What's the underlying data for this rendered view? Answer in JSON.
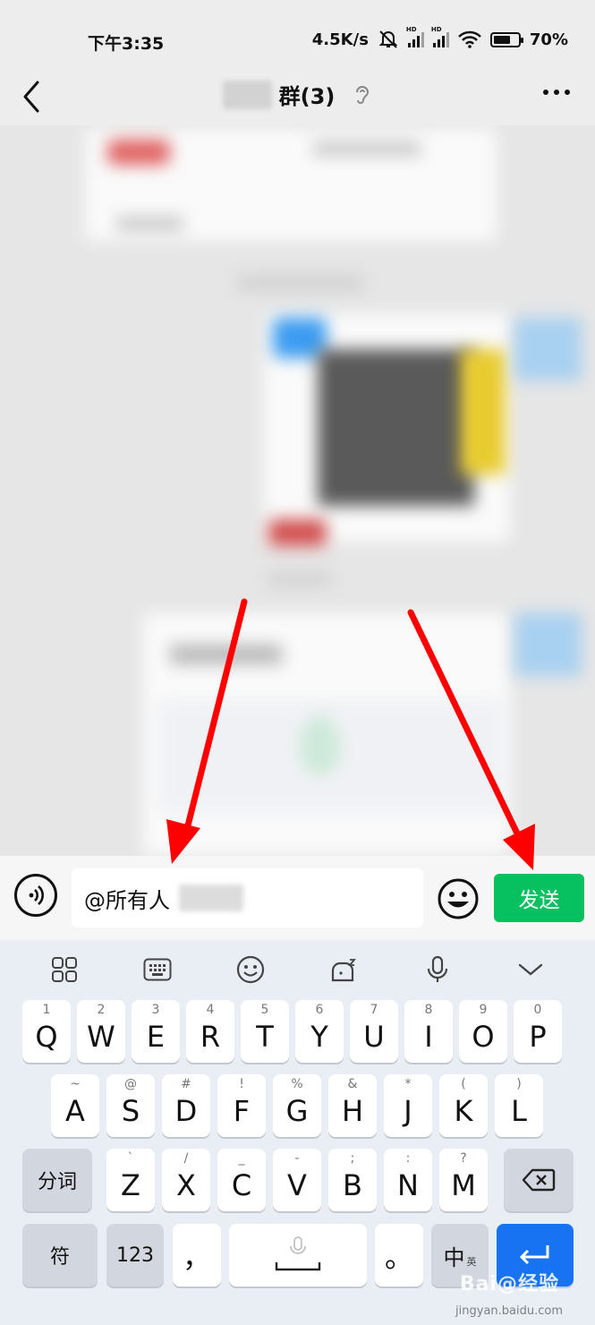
{
  "status_bar": {
    "time": "下午3:35",
    "net_speed": "4.5K/s",
    "signal_tag_1": "HD",
    "signal_tag_2": "HD",
    "battery": "70%"
  },
  "header": {
    "title": "群(3)",
    "icons": [
      "back-icon",
      "ear-icon",
      "more-icon"
    ]
  },
  "input_bar": {
    "text_value": "@所有人",
    "send_label": "发送",
    "icons": [
      "voice-icon",
      "emoji-icon"
    ]
  },
  "keyboard": {
    "toolbar_icons": [
      "apps-grid-icon",
      "keyboard-icon",
      "emoji-icon",
      "skin-icon",
      "mic-icon",
      "collapse-icon"
    ],
    "row1": [
      {
        "k": "Q",
        "h": "1"
      },
      {
        "k": "W",
        "h": "2"
      },
      {
        "k": "E",
        "h": "3"
      },
      {
        "k": "R",
        "h": "4"
      },
      {
        "k": "T",
        "h": "5"
      },
      {
        "k": "Y",
        "h": "6"
      },
      {
        "k": "U",
        "h": "7"
      },
      {
        "k": "I",
        "h": "8"
      },
      {
        "k": "O",
        "h": "9"
      },
      {
        "k": "P",
        "h": "0"
      }
    ],
    "row2": [
      {
        "k": "A",
        "h": "~"
      },
      {
        "k": "S",
        "h": "@"
      },
      {
        "k": "D",
        "h": "#"
      },
      {
        "k": "F",
        "h": "!"
      },
      {
        "k": "G",
        "h": "%"
      },
      {
        "k": "H",
        "h": "&"
      },
      {
        "k": "J",
        "h": "*"
      },
      {
        "k": "K",
        "h": "("
      },
      {
        "k": "L",
        "h": ")"
      }
    ],
    "row3": [
      {
        "k": "Z",
        "h": "`"
      },
      {
        "k": "X",
        "h": "/"
      },
      {
        "k": "C",
        "h": "_"
      },
      {
        "k": "V",
        "h": "-"
      },
      {
        "k": "B",
        "h": ";"
      },
      {
        "k": "N",
        "h": ":"
      },
      {
        "k": "M",
        "h": "?"
      }
    ],
    "fenci_label": "分词",
    "fu_label": "符",
    "num_label": "123",
    "comma_label": "，",
    "period_label": "。",
    "zh_label": "中",
    "en_label": "英"
  },
  "watermark": {
    "text": "Bai@经验",
    "url": "jingyan.baidu.com"
  },
  "colors": {
    "send_green": "#07c160",
    "enter_blue": "#1773f2",
    "arrow_red": "#ff0000"
  }
}
